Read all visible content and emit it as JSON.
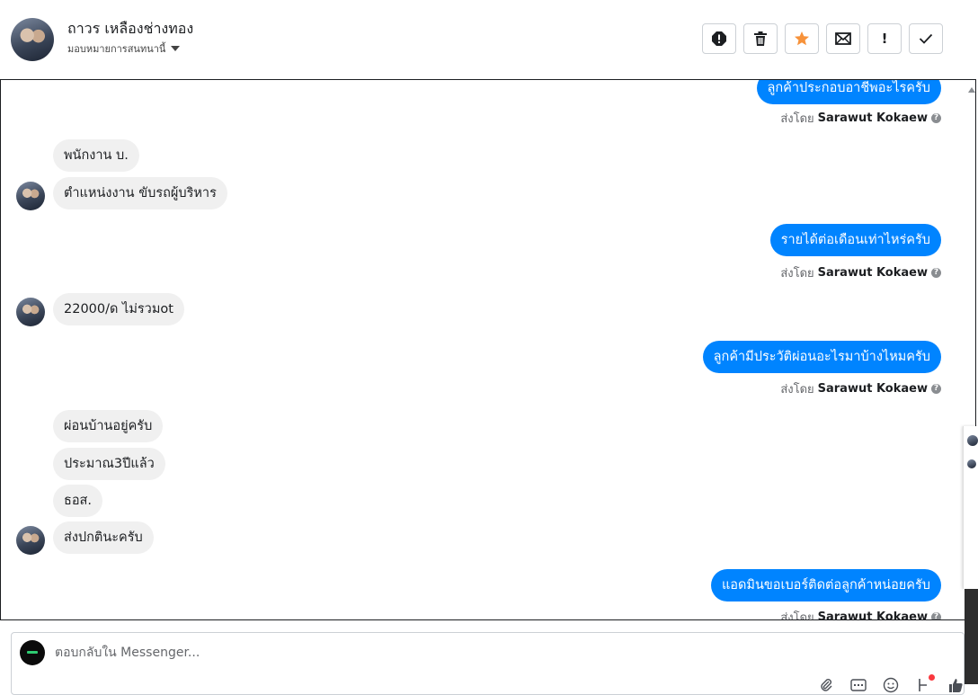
{
  "header": {
    "contact_name": "ถาวร เหลืองช่างทอง",
    "assign_label": "มอบหมายการสนทนานี้"
  },
  "toolbar": [
    {
      "name": "spam-icon"
    },
    {
      "name": "trash-icon"
    },
    {
      "name": "star-icon",
      "color": "#f7923a"
    },
    {
      "name": "mail-icon"
    },
    {
      "name": "exclamation-icon",
      "label": "!"
    },
    {
      "name": "check-icon"
    }
  ],
  "thread": {
    "messages": [
      {
        "dir": "out",
        "text": "ลูกค้าประกอบอาชีพอะไรครับ",
        "sent_by_prefix": "ส่งโดย",
        "sent_by_name": "Sarawut Kokaew"
      },
      {
        "dir": "in",
        "text": "พนักงาน บ."
      },
      {
        "dir": "in",
        "text": "ตำแหน่งงาน ขับรถผู้บริหาร"
      },
      {
        "dir": "out",
        "text": "รายได้ต่อเดือนเท่าไหร่ครับ",
        "sent_by_prefix": "ส่งโดย",
        "sent_by_name": "Sarawut Kokaew"
      },
      {
        "dir": "in",
        "text": "22000/ด ไม่รวมot"
      },
      {
        "dir": "out",
        "text": "ลูกค้ามีประวัติผ่อนอะไรมาบ้างไหมครับ",
        "sent_by_prefix": "ส่งโดย",
        "sent_by_name": "Sarawut Kokaew"
      },
      {
        "dir": "in",
        "text": "ผ่อนบ้านอยู่ครับ"
      },
      {
        "dir": "in",
        "text": "ประมาณ3ปีแล้ว"
      },
      {
        "dir": "in",
        "text": "ธอส."
      },
      {
        "dir": "in",
        "text": "ส่งปกตินะครับ"
      },
      {
        "dir": "out",
        "text": "แอดมินขอเบอร์ติดต่อลูกค้าหน่อยครับ",
        "sent_by_prefix": "ส่งโดย",
        "sent_by_name": "Sarawut Kokaew"
      }
    ]
  },
  "composer": {
    "placeholder": "ตอบกลับใน Messenger...",
    "icons": [
      "attach-icon",
      "gif-icon",
      "emoji-icon",
      "sticker-icon",
      "like-icon"
    ]
  },
  "colors": {
    "outgoing_bubble": "#0084ff",
    "incoming_bubble": "#f0f0f0"
  }
}
